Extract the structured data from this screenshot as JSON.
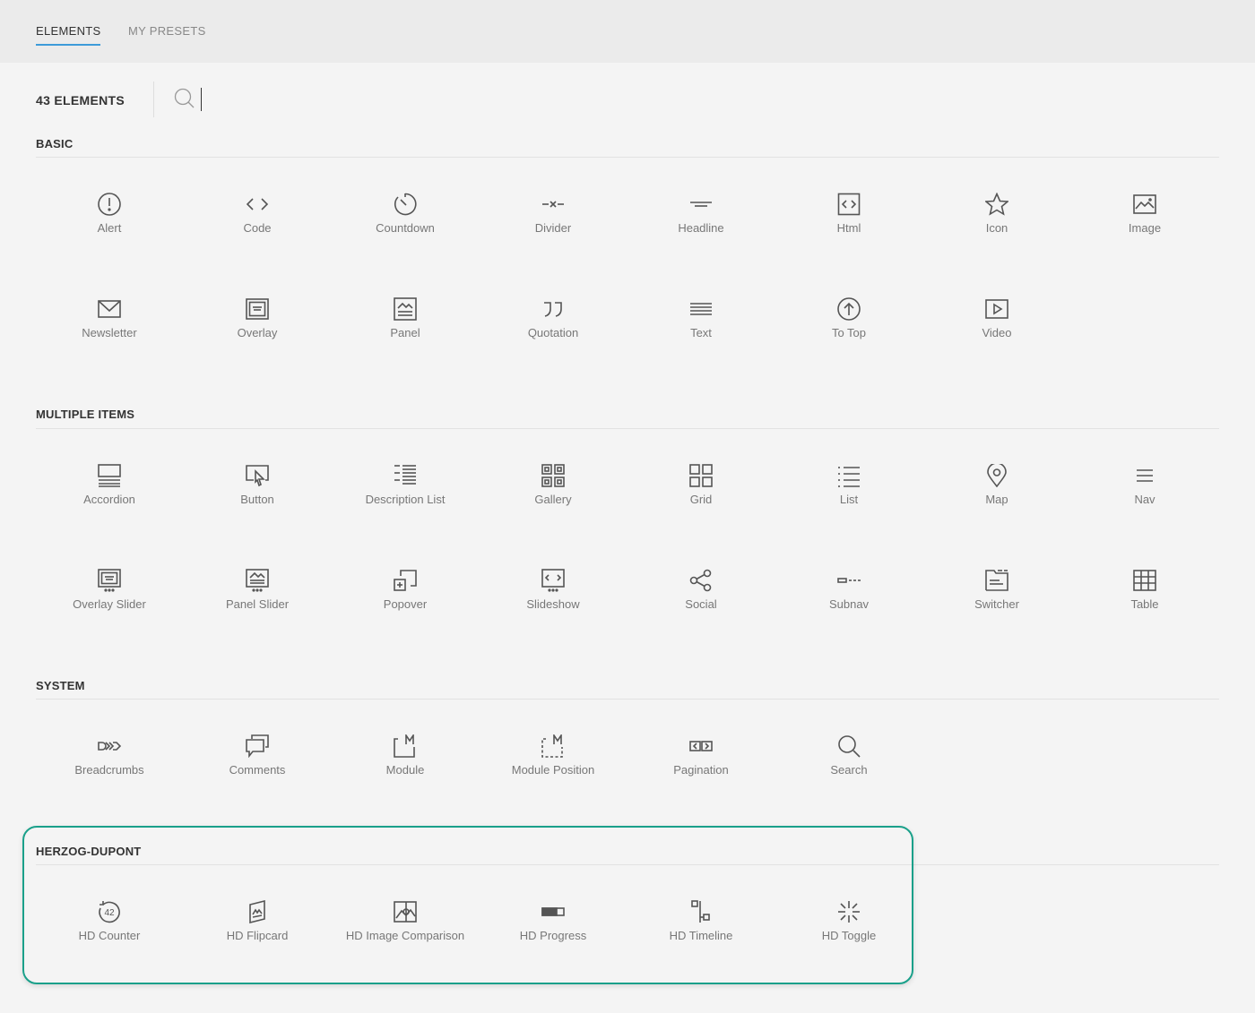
{
  "tabs": [
    {
      "label": "Elements",
      "active": true
    },
    {
      "label": "My Presets",
      "active": false
    }
  ],
  "toolbar": {
    "count_label": "43 Elements",
    "search_placeholder": ""
  },
  "sections": [
    {
      "title": "Basic",
      "items": [
        "Alert",
        "Code",
        "Countdown",
        "Divider",
        "Headline",
        "Html",
        "Icon",
        "Image",
        "Newsletter",
        "Overlay",
        "Panel",
        "Quotation",
        "Text",
        "To Top",
        "Video"
      ]
    },
    {
      "title": "Multiple Items",
      "items": [
        "Accordion",
        "Button",
        "Description List",
        "Gallery",
        "Grid",
        "List",
        "Map",
        "Nav",
        "Overlay Slider",
        "Panel Slider",
        "Popover",
        "Slideshow",
        "Social",
        "Subnav",
        "Switcher",
        "Table"
      ]
    },
    {
      "title": "System",
      "items": [
        "Breadcrumbs",
        "Comments",
        "Module",
        "Module Position",
        "Pagination",
        "Search"
      ]
    },
    {
      "title": "Herzog-Dupont",
      "items": [
        "HD Counter",
        "HD Flipcard",
        "HD Image Comparison",
        "HD Progress",
        "HD Timeline",
        "HD Toggle"
      ]
    }
  ],
  "icons": {
    "basic": [
      "alert-icon",
      "code-icon",
      "countdown-icon",
      "divider-icon",
      "headline-icon",
      "html-icon",
      "star-icon",
      "image-icon",
      "envelope-icon",
      "overlay-icon",
      "panel-icon",
      "quotation-icon",
      "text-icon",
      "arrow-up-circle-icon",
      "video-icon"
    ],
    "multiple": [
      "accordion-icon",
      "button-icon",
      "description-list-icon",
      "gallery-icon",
      "grid-icon",
      "list-icon",
      "map-pin-icon",
      "nav-icon",
      "overlay-slider-icon",
      "panel-slider-icon",
      "popover-icon",
      "slideshow-icon",
      "social-icon",
      "subnav-icon",
      "switcher-icon",
      "table-icon"
    ],
    "system": [
      "breadcrumbs-icon",
      "comments-icon",
      "module-icon",
      "module-position-icon",
      "pagination-icon",
      "search-icon"
    ],
    "herzog": [
      "hd-counter-icon",
      "hd-flipcard-icon",
      "hd-image-comparison-icon",
      "hd-progress-icon",
      "hd-timeline-icon",
      "hd-toggle-icon"
    ]
  },
  "hd_counter_value": "42",
  "colors": {
    "accent": "#3d9bd9",
    "highlight_border": "#1aa08a",
    "background": "#f4f4f4",
    "header_bg": "#ebebeb"
  }
}
